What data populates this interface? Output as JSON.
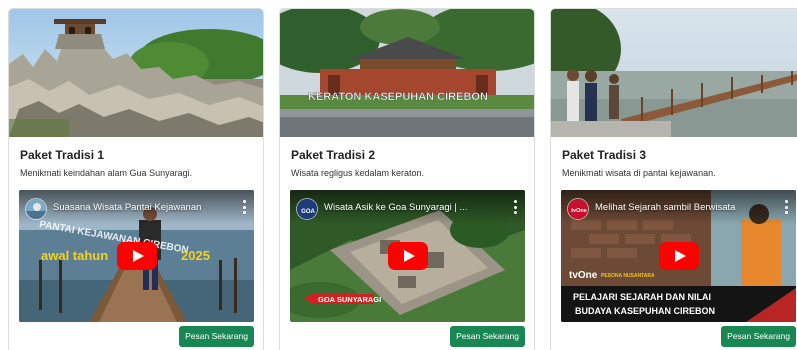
{
  "cards": [
    {
      "title": "Paket Tradisi 1",
      "description": "Menikmati keindahan alam Gua Sunyaragi.",
      "video": {
        "title": "Suasana Wisata Pantai Kejawanan",
        "overlay_text": "awal tahun",
        "overlay_year": "2025",
        "banner_text": "PANTAI KEJAWANAN CIREBON"
      },
      "button_label": "Pesan Sekarang"
    },
    {
      "title": "Paket Tradisi 2",
      "description": "Wisata regligus kedalam keraton.",
      "thumb_sign": "KERATON KASEPUHAN CIREBON",
      "video": {
        "title": "Wisata Asik ke Goa Sunyaragi | ...",
        "channel_badge": "GOA",
        "map_label": "GOA SUNYARAGI"
      },
      "button_label": "Pesan Sekarang"
    },
    {
      "title": "Paket Tradisi 3",
      "description": "Menikmati wisata di pantai kejawanan.",
      "video": {
        "title": "Melihat Sejarah sambil Berwisata",
        "channel_badge": "tvOne",
        "brand": "tvOne",
        "program": "PESONA NUSANTARA",
        "caption_line1": "PELAJARI SEJARAH DAN NILAI",
        "caption_line2": "BUDAYA KASEPUHAN CIREBON"
      },
      "button_label": "Pesan Sekarang"
    }
  ],
  "colors": {
    "button_bg": "#198754",
    "youtube_red": "#ff0000",
    "card_border": "#dcdcdc"
  },
  "icons": {
    "play": "youtube-play-icon",
    "menu": "more-vertical-icon"
  }
}
